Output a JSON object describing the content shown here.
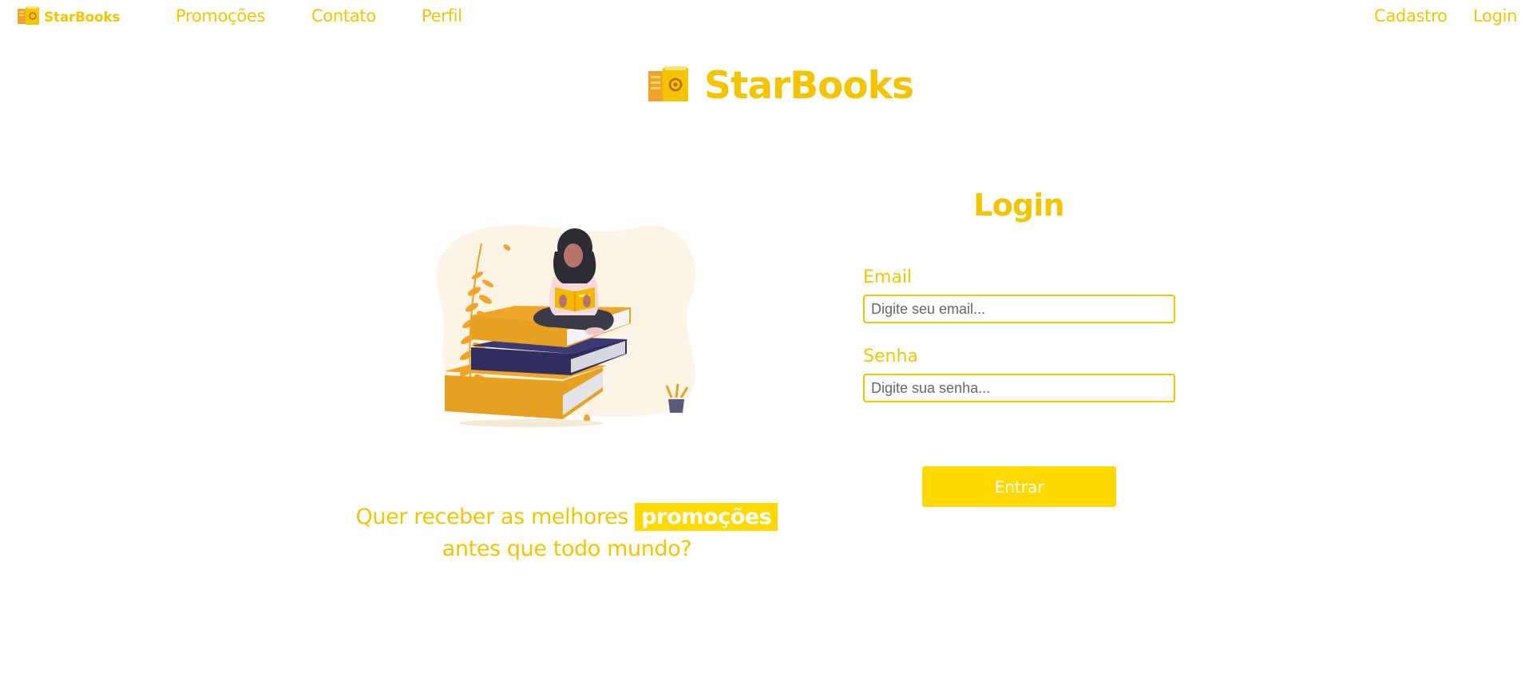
{
  "nav": {
    "brand": "StarBooks",
    "links": [
      "Promoções",
      "Contato",
      "Perfil"
    ],
    "right_links": [
      "Cadastro",
      "Login"
    ]
  },
  "hero": {
    "title": "StarBooks"
  },
  "promo": {
    "text_before": "Quer receber as melhores",
    "highlight": "promoções",
    "text_after": "antes que todo mundo?"
  },
  "login": {
    "title": "Login",
    "email_label": "Email",
    "email_placeholder": "Digite seu email...",
    "password_label": "Senha",
    "password_placeholder": "Digite sua senha...",
    "submit": "Entrar"
  },
  "colors": {
    "accent": "#f5c400",
    "button": "#ffd800",
    "book_orange": "#e8a020",
    "book_navy": "#2f2e5e"
  },
  "icons": [
    "book-logo-icon",
    "reading-woman-illustration"
  ]
}
